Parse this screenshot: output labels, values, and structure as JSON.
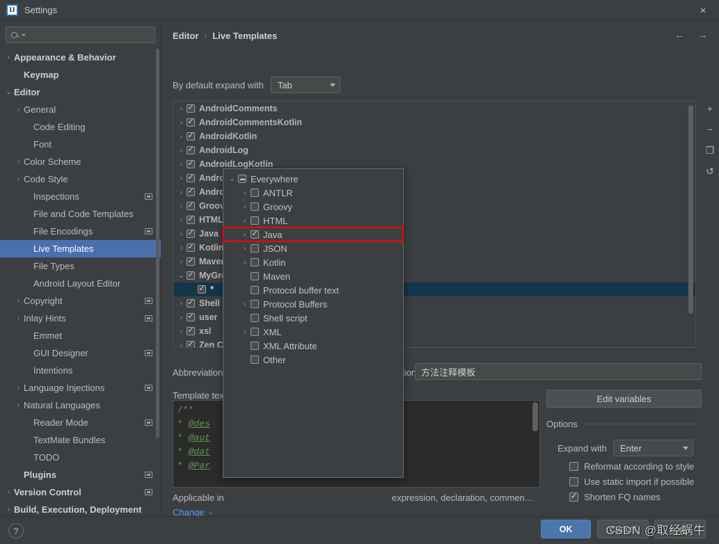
{
  "window": {
    "title": "Settings",
    "logo_text": "IJ",
    "close_icon": "×"
  },
  "sidebar": {
    "search_placeholder": "",
    "items": [
      {
        "label": "Appearance & Behavior",
        "indent": 0,
        "chevron": "›",
        "bold": true,
        "selected": false,
        "project_icon": false
      },
      {
        "label": "Keymap",
        "indent": 1,
        "chevron": "",
        "bold": true,
        "selected": false,
        "project_icon": false
      },
      {
        "label": "Editor",
        "indent": 0,
        "chevron": "⌄",
        "bold": true,
        "selected": false,
        "project_icon": false
      },
      {
        "label": "General",
        "indent": 1,
        "chevron": "›",
        "bold": false,
        "selected": false,
        "project_icon": false
      },
      {
        "label": "Code Editing",
        "indent": 2,
        "chevron": "",
        "bold": false,
        "selected": false,
        "project_icon": false
      },
      {
        "label": "Font",
        "indent": 2,
        "chevron": "",
        "bold": false,
        "selected": false,
        "project_icon": false
      },
      {
        "label": "Color Scheme",
        "indent": 1,
        "chevron": "›",
        "bold": false,
        "selected": false,
        "project_icon": false
      },
      {
        "label": "Code Style",
        "indent": 1,
        "chevron": "›",
        "bold": false,
        "selected": false,
        "project_icon": false
      },
      {
        "label": "Inspections",
        "indent": 2,
        "chevron": "",
        "bold": false,
        "selected": false,
        "project_icon": true
      },
      {
        "label": "File and Code Templates",
        "indent": 2,
        "chevron": "",
        "bold": false,
        "selected": false,
        "project_icon": false
      },
      {
        "label": "File Encodings",
        "indent": 2,
        "chevron": "",
        "bold": false,
        "selected": false,
        "project_icon": true
      },
      {
        "label": "Live Templates",
        "indent": 2,
        "chevron": "",
        "bold": false,
        "selected": true,
        "project_icon": false
      },
      {
        "label": "File Types",
        "indent": 2,
        "chevron": "",
        "bold": false,
        "selected": false,
        "project_icon": false
      },
      {
        "label": "Android Layout Editor",
        "indent": 2,
        "chevron": "",
        "bold": false,
        "selected": false,
        "project_icon": false
      },
      {
        "label": "Copyright",
        "indent": 1,
        "chevron": "›",
        "bold": false,
        "selected": false,
        "project_icon": true
      },
      {
        "label": "Inlay Hints",
        "indent": 1,
        "chevron": "›",
        "bold": false,
        "selected": false,
        "project_icon": true
      },
      {
        "label": "Emmet",
        "indent": 2,
        "chevron": "",
        "bold": false,
        "selected": false,
        "project_icon": false
      },
      {
        "label": "GUI Designer",
        "indent": 2,
        "chevron": "",
        "bold": false,
        "selected": false,
        "project_icon": true
      },
      {
        "label": "Intentions",
        "indent": 2,
        "chevron": "",
        "bold": false,
        "selected": false,
        "project_icon": false
      },
      {
        "label": "Language Injections",
        "indent": 1,
        "chevron": "›",
        "bold": false,
        "selected": false,
        "project_icon": true
      },
      {
        "label": "Natural Languages",
        "indent": 1,
        "chevron": "›",
        "bold": false,
        "selected": false,
        "project_icon": false
      },
      {
        "label": "Reader Mode",
        "indent": 2,
        "chevron": "",
        "bold": false,
        "selected": false,
        "project_icon": true
      },
      {
        "label": "TextMate Bundles",
        "indent": 2,
        "chevron": "",
        "bold": false,
        "selected": false,
        "project_icon": false
      },
      {
        "label": "TODO",
        "indent": 2,
        "chevron": "",
        "bold": false,
        "selected": false,
        "project_icon": false
      },
      {
        "label": "Plugins",
        "indent": 1,
        "chevron": "",
        "bold": true,
        "selected": false,
        "project_icon": true
      },
      {
        "label": "Version Control",
        "indent": 0,
        "chevron": "›",
        "bold": true,
        "selected": false,
        "project_icon": true
      },
      {
        "label": "Build, Execution, Deployment",
        "indent": 0,
        "chevron": "›",
        "bold": true,
        "selected": false,
        "project_icon": false
      }
    ]
  },
  "breadcrumb": {
    "parent": "Editor",
    "separator": "›",
    "current": "Live Templates"
  },
  "nav": {
    "back_icon": "←",
    "forward_icon": "→"
  },
  "expand_with": {
    "label": "By default expand with",
    "value": "Tab"
  },
  "template_list": {
    "rows": [
      {
        "chevron": "›",
        "checked": true,
        "name": "AndroidComments",
        "selected": false
      },
      {
        "chevron": "›",
        "checked": true,
        "name": "AndroidCommentsKotlin",
        "selected": false
      },
      {
        "chevron": "›",
        "checked": true,
        "name": "AndroidKotlin",
        "selected": false
      },
      {
        "chevron": "›",
        "checked": true,
        "name": "AndroidLog",
        "selected": false
      },
      {
        "chevron": "›",
        "checked": true,
        "name": "AndroidLogKotlin",
        "selected": false
      },
      {
        "chevron": "›",
        "checked": true,
        "name": "AndroidParcelable",
        "selected": false
      },
      {
        "chevron": "›",
        "checked": true,
        "name": "AndroidXML",
        "selected": false
      },
      {
        "chevron": "›",
        "checked": true,
        "name": "Groovy",
        "selected": false
      },
      {
        "chevron": "›",
        "checked": true,
        "name": "HTML/XML",
        "selected": false
      },
      {
        "chevron": "›",
        "checked": true,
        "name": "Java",
        "selected": false
      },
      {
        "chevron": "›",
        "checked": true,
        "name": "Kotlin",
        "selected": false
      },
      {
        "chevron": "›",
        "checked": true,
        "name": "Maven",
        "selected": false
      },
      {
        "chevron": "⌄",
        "checked": true,
        "name": "MyGroup",
        "selected": false
      },
      {
        "chevron": "",
        "checked": true,
        "name": "*",
        "selected": true
      },
      {
        "chevron": "›",
        "checked": true,
        "name": "Shell Script",
        "selected": false
      },
      {
        "chevron": "›",
        "checked": true,
        "name": "user",
        "selected": false
      },
      {
        "chevron": "›",
        "checked": true,
        "name": "xsl",
        "selected": false
      },
      {
        "chevron": "›",
        "checked": true,
        "name": "Zen CSS",
        "selected": false
      }
    ]
  },
  "side_tools": [
    {
      "icon": "+",
      "name": "add-template-button"
    },
    {
      "icon": "−",
      "name": "remove-template-button"
    },
    {
      "icon": "❐",
      "name": "duplicate-template-button"
    },
    {
      "icon": "↺",
      "name": "restore-defaults-button"
    }
  ],
  "form": {
    "abbreviation_label": "Abbreviation:",
    "abbreviation_value": "",
    "description_label": "Description:",
    "description_value": "方法注释模板",
    "template_text_label": "Template text:",
    "applicable_label": "Applicable in",
    "applicable_text": "expression, declaration, commen…",
    "change_link": "Change",
    "change_caret": "⌄",
    "edit_variables_label": "Edit variables"
  },
  "code": {
    "lines": [
      "/**",
      " * @des",
      " * @aut",
      " * @dat",
      " * @Par"
    ]
  },
  "options": {
    "legend": "Options",
    "expand_with_label": "Expand with",
    "expand_with_value": "Enter",
    "checkboxes": [
      {
        "label": "Reformat according to style",
        "checked": false
      },
      {
        "label": "Use static import if possible",
        "checked": false
      },
      {
        "label": "Shorten FQ names",
        "checked": true
      }
    ]
  },
  "popup": {
    "items": [
      {
        "label": "Everywhere",
        "indent": 0,
        "chevron": "⌄",
        "state": "dash",
        "highlight": false
      },
      {
        "label": "ANTLR",
        "indent": 1,
        "chevron": "›",
        "state": "unchecked",
        "highlight": false
      },
      {
        "label": "Groovy",
        "indent": 1,
        "chevron": "›",
        "state": "unchecked",
        "highlight": false
      },
      {
        "label": "HTML",
        "indent": 1,
        "chevron": "›",
        "state": "unchecked",
        "highlight": false
      },
      {
        "label": "Java",
        "indent": 1,
        "chevron": "›",
        "state": "checked",
        "highlight": true
      },
      {
        "label": "JSON",
        "indent": 1,
        "chevron": "›",
        "state": "unchecked",
        "highlight": false
      },
      {
        "label": "Kotlin",
        "indent": 1,
        "chevron": "›",
        "state": "unchecked",
        "highlight": false
      },
      {
        "label": "Maven",
        "indent": 1,
        "chevron": "",
        "state": "unchecked",
        "highlight": false
      },
      {
        "label": "Protocol buffer text",
        "indent": 1,
        "chevron": "",
        "state": "unchecked",
        "highlight": false
      },
      {
        "label": "Protocol Buffers",
        "indent": 1,
        "chevron": "›",
        "state": "unchecked",
        "highlight": false
      },
      {
        "label": "Shell script",
        "indent": 1,
        "chevron": "",
        "state": "unchecked",
        "highlight": false
      },
      {
        "label": "XML",
        "indent": 1,
        "chevron": "›",
        "state": "unchecked",
        "highlight": false
      },
      {
        "label": "XML Attribute",
        "indent": 1,
        "chevron": "",
        "state": "unchecked",
        "highlight": false
      },
      {
        "label": "Other",
        "indent": 1,
        "chevron": "",
        "state": "unchecked",
        "highlight": false
      }
    ],
    "highlight_color": "#ff0000"
  },
  "footer": {
    "help_icon": "?",
    "ok_label": "OK",
    "cancel_label": "Cancel",
    "apply_label": "Apply",
    "watermark": "CSDN @取经蜗牛"
  },
  "colors": {
    "background": "#3c3f41",
    "selection_blue": "#4b6eaf",
    "list_selection": "#13354a",
    "accent_link": "#589df6",
    "ok_button": "#4a76ac",
    "code_green": "#629755",
    "highlight_red": "#ff0000"
  }
}
